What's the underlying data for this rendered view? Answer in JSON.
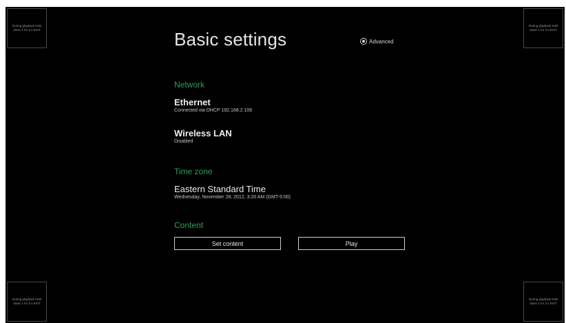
{
  "corners": {
    "notice": "During playback hold down 1 for 3 s EXIT"
  },
  "header": {
    "title": "Basic settings",
    "advanced_label": "Advanced"
  },
  "network": {
    "header": "Network",
    "ethernet": {
      "title": "Ethernet",
      "status": "Connected via DHCP 192.168.2.106"
    },
    "wireless": {
      "title": "Wireless LAN",
      "status": "Disabled"
    }
  },
  "timezone": {
    "header": "Time zone",
    "title": "Eastern Standard Time",
    "datetime": "Wednesday, November 28, 2012, 3:20 AM (GMT-5:00)"
  },
  "content": {
    "header": "Content",
    "set_content_label": "Set content",
    "play_label": "Play"
  },
  "colors": {
    "background": "#000000",
    "section_header": "#2f9e5a",
    "text": "#eeeeee"
  }
}
